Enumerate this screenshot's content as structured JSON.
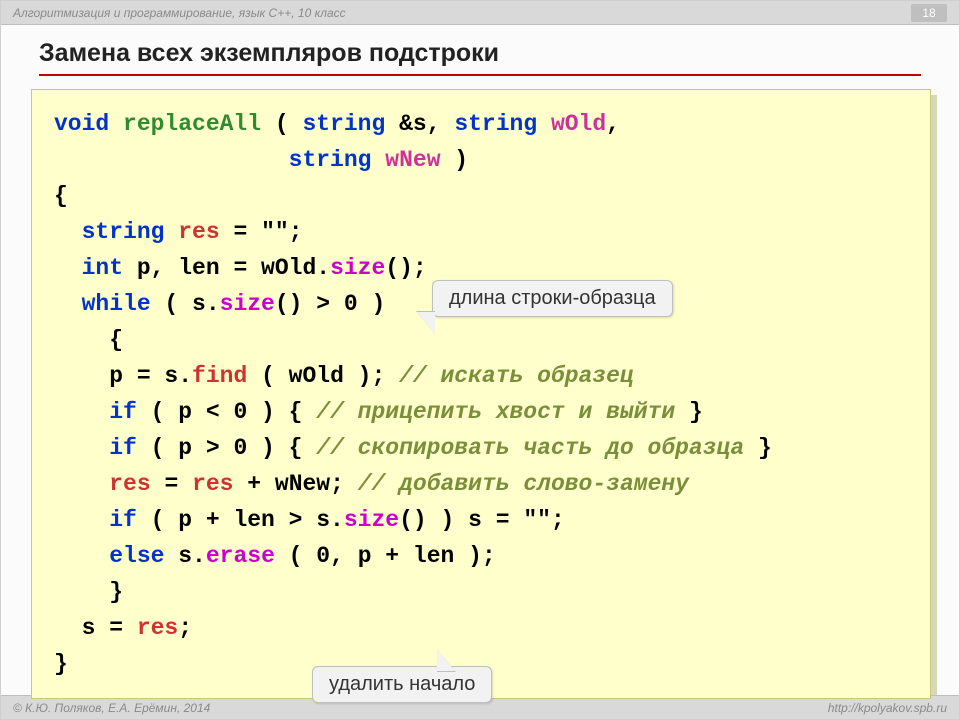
{
  "header": {
    "subject": "Алгоритмизация и программирование, язык C++, 10 класс",
    "page_number": "18"
  },
  "title": "Замена всех экземпляров подстроки",
  "callouts": {
    "c1": "длина строки-образца",
    "c2": "удалить начало"
  },
  "code": {
    "l1": {
      "a": "void ",
      "b": "replaceAll",
      "c": " ( ",
      "d": "string",
      "e": " &s, ",
      "f": "string",
      "g": " ",
      "h": "wOld",
      "i": ","
    },
    "l2": {
      "a": "                 ",
      "b": "string",
      "c": " ",
      "d": "wNew",
      "e": " )"
    },
    "l3": "{",
    "l4": {
      "a": "  ",
      "b": "string",
      "c": " ",
      "d": "res",
      "e": " = \"\";"
    },
    "l5": {
      "a": "  ",
      "b": "int",
      "c": " p, len = wOld.",
      "d": "size",
      "e": "();"
    },
    "l6": {
      "a": "  ",
      "b": "while",
      "c": " ( s.",
      "d": "size",
      "e": "() > 0 )"
    },
    "l7": "    {",
    "l8": {
      "a": "    p = s.",
      "b": "find",
      "c": " ( wOld ); ",
      "d": "// искать образец"
    },
    "l9": {
      "a": "    ",
      "b": "if",
      "c": " ( p < 0 ) { ",
      "d": "// прицепить хвост и выйти ",
      "e": "}"
    },
    "l10": {
      "a": "    ",
      "b": "if",
      "c": " ( p > 0 ) { ",
      "d": "// скопировать часть до образца ",
      "e": "}"
    },
    "l11": {
      "a": "    ",
      "b": "res",
      "c": " = ",
      "d": "res",
      "e": " + wNew; ",
      "f": "// добавить слово-замену"
    },
    "l12": {
      "a": "    ",
      "b": "if",
      "c": " ( p + len > s.",
      "d": "size",
      "e": "() ) s = \"\";"
    },
    "l13": {
      "a": "    ",
      "b": "else",
      "c": " s.",
      "d": "erase",
      "e": " ( 0, p + len );"
    },
    "l14": "    }",
    "l15": {
      "a": "  s = ",
      "b": "res",
      "c": ";"
    },
    "l16": "}"
  },
  "footer": {
    "copyright": "© К.Ю. Поляков, Е.А. Ерёмин, 2014",
    "url": "http://kpolyakov.spb.ru"
  }
}
